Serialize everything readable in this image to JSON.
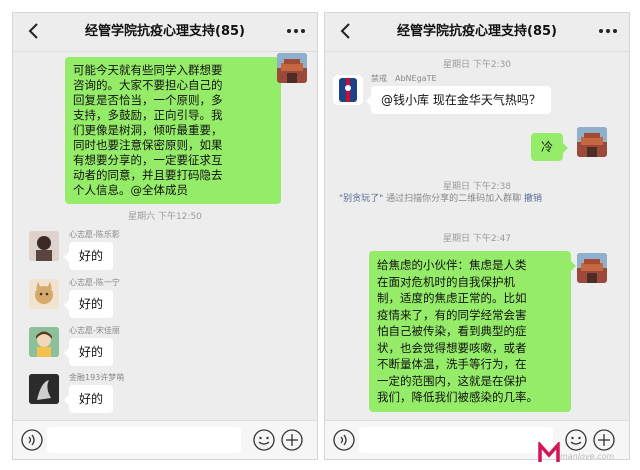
{
  "left": {
    "title": "经管学院抗疫心理支持(85)",
    "intro_message": [
      "可能今天就有些同学入群想要",
      "咨询的。大家不要担心自己的",
      "回复是否恰当，一个原则，多",
      "支持，多鼓励，正向引导。我",
      "们更像是树洞，倾听最重要，",
      "同时也要注意保密原则，如果",
      "有想要分享的，一定要征求互",
      "动者的同意，并且要打码隐去",
      "个人信息。@全体成员"
    ],
    "time": "星期六 下午12:50",
    "replies": [
      {
        "name": "心志愿-陈乐影",
        "text": "好的"
      },
      {
        "name": "心志愿-陈一宁",
        "text": "好的"
      },
      {
        "name": "心志愿-宋佳丽",
        "text": "好的"
      },
      {
        "name": "金融193许梦萌",
        "text": "好的"
      }
    ]
  },
  "right": {
    "title": "经管学院抗疫心理支持(85)",
    "time1": "星期日 下午2:30",
    "sender_name": "禁戒　AbNEgaTE",
    "question": "@钱小库  现在金华天气热吗？",
    "answer": "冷",
    "time2": "星期日 下午2:38",
    "sys_name": "\"别贪玩了\"",
    "sys_text": "通过扫描你分享的二维码加入群聊",
    "sys_revoke": "撤销",
    "time3": "星期日 下午2:47",
    "long_message": [
      "给焦虑的小伙伴：焦虑是人类",
      "在面对危机时的自我保护机",
      "制，适度的焦虑正常的。比如",
      "疫情来了，有的同学经常会害",
      "怕自己被传染，看到典型的症",
      "状，也会觉得想要咳嗽，或者",
      "不断量体温，洗手等行为，在",
      "一定的范围内，这就是在保护",
      "我们，降低我们被感染的几率。"
    ]
  },
  "watermark_text": "manlove.com",
  "colors": {
    "green_bubble": "#95ec69",
    "white_bubble": "#ffffff",
    "background": "#ededed",
    "link": "#576b95"
  }
}
